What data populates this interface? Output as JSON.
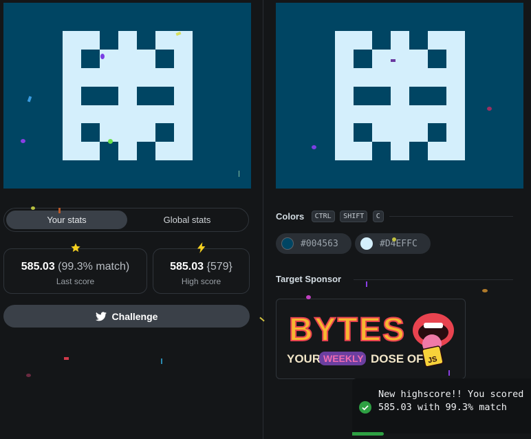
{
  "colors": {
    "background": "#141618",
    "canvas": "#004563",
    "shape": "#D4EFFC",
    "toast_success": "#2ea043",
    "star": "#f5d020"
  },
  "stats_tabs": [
    {
      "label": "Your stats",
      "active": true
    },
    {
      "label": "Global stats",
      "active": false
    }
  ],
  "stats": {
    "last": {
      "score": "585.03",
      "match": "(99.3% match)",
      "label": "Last score",
      "icon": "star-icon"
    },
    "high": {
      "score": "585.03",
      "rank": "{579}",
      "label": "High score",
      "icon": "lightning-icon"
    }
  },
  "challenge": {
    "label": "Challenge",
    "icon": "twitter-icon"
  },
  "colors_section": {
    "title": "Colors",
    "shortcut_keys": [
      "CTRL",
      "SHIFT",
      "C"
    ],
    "swatches": [
      {
        "hex": "#004563",
        "label": "#004563"
      },
      {
        "hex": "#D4EFFC",
        "label": "#D4EFFC"
      }
    ]
  },
  "sponsor": {
    "title": "Target Sponsor",
    "logo_text": "BYTES",
    "tagline_left": "YOUR",
    "tagline_badge": "WEEKLY",
    "tagline_right": "DOSE OF",
    "js_badge": "JS"
  },
  "toast": {
    "message": "New highscore!! You scored 585.03 with 99.3% match",
    "icon": "check-circle-icon"
  }
}
